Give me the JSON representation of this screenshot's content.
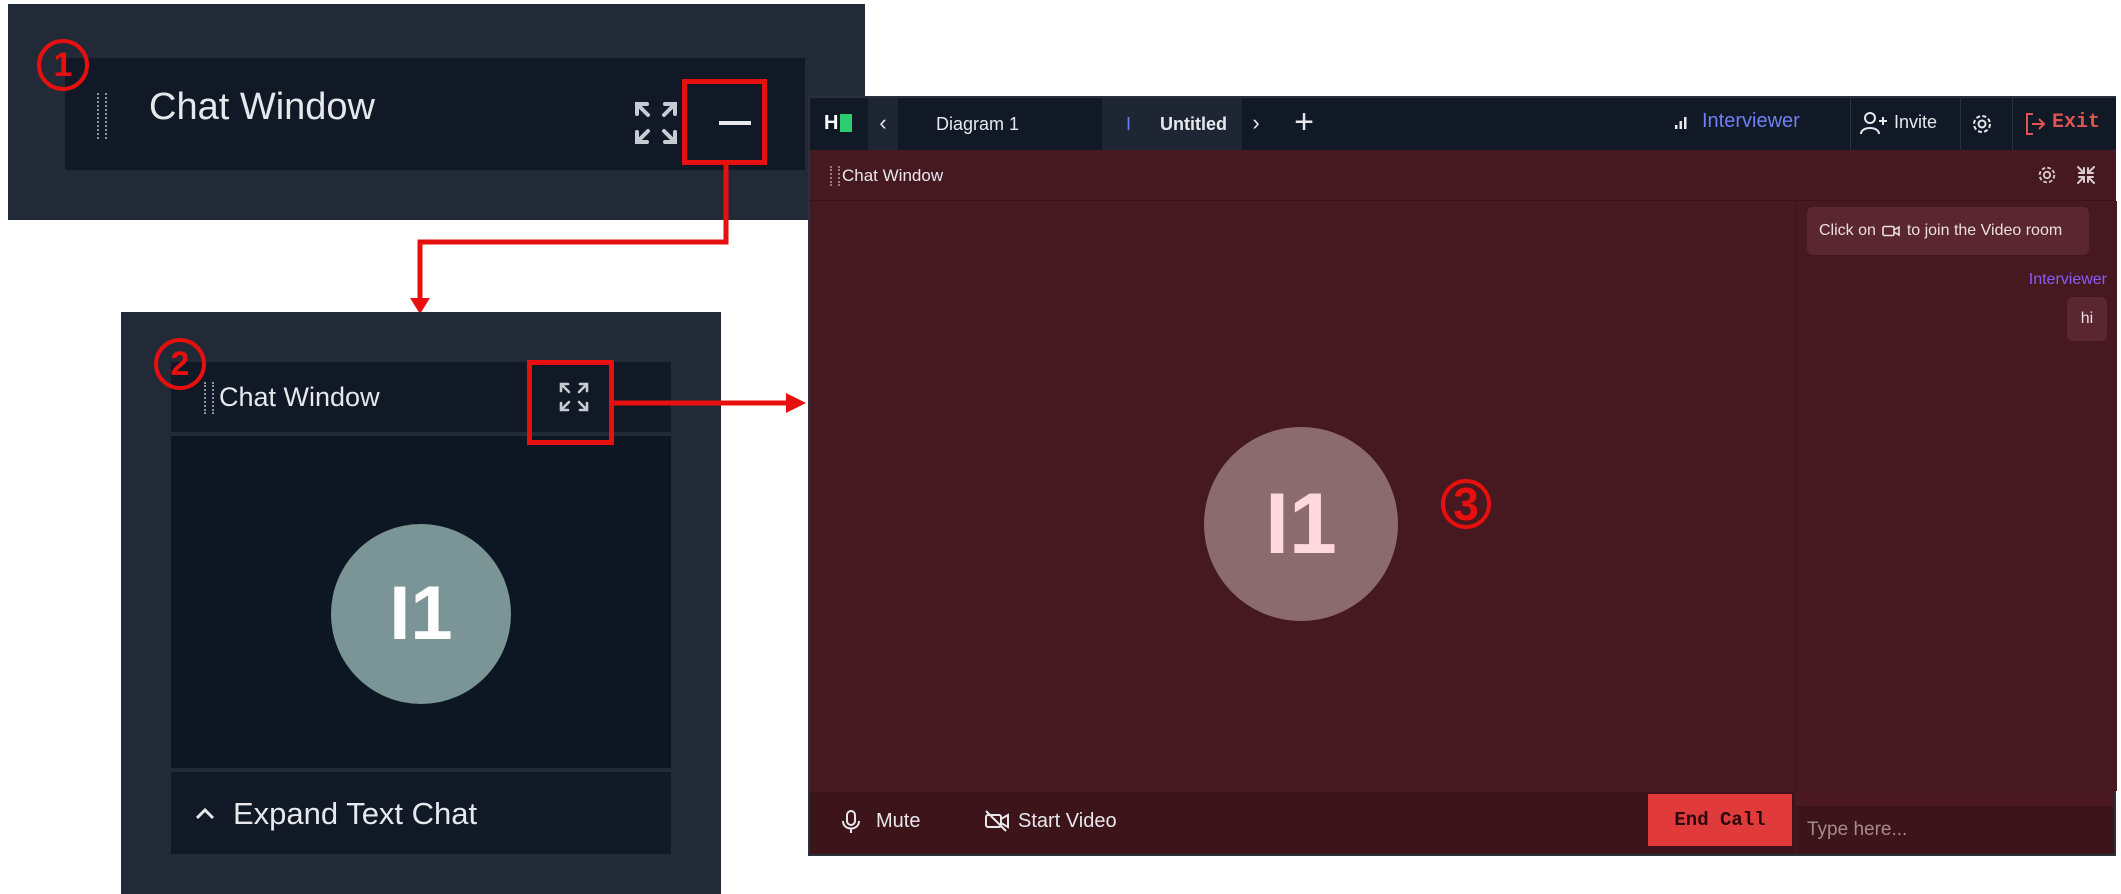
{
  "markers": {
    "step1": "1",
    "step2": "2",
    "step3": "3"
  },
  "colors": {
    "annotation_red": "#e8100f",
    "dark_bg": "#222a38",
    "panel_bg": "#111926",
    "room_bg": "#461820",
    "interviewer": "#8a5cf6",
    "end_call": "#e03a3a"
  },
  "panel1": {
    "title": "Chat Window",
    "icons": [
      "expand-icon",
      "minimize-icon"
    ]
  },
  "panel2": {
    "title": "Chat Window",
    "avatar_initials": "I1",
    "expand_text_chat": "Expand Text Chat",
    "icons": [
      "expand-icon",
      "chevron-up-icon"
    ]
  },
  "panel3": {
    "logo_text": "H",
    "tabs": [
      {
        "label": "Diagram 1"
      },
      {
        "label": "Untitled",
        "prefix": "I"
      }
    ],
    "role": "Interviewer",
    "invite": "Invite",
    "exit": "Exit",
    "chat_title": "Chat Window",
    "avatar_initials": "I1",
    "notice_prefix": "Click on",
    "notice_suffix": "to join the Video room",
    "message_author": "Interviewer",
    "message_text": "hi",
    "mute": "Mute",
    "start_video": "Start Video",
    "end_call": "End Call",
    "input_placeholder": "Type here..."
  }
}
